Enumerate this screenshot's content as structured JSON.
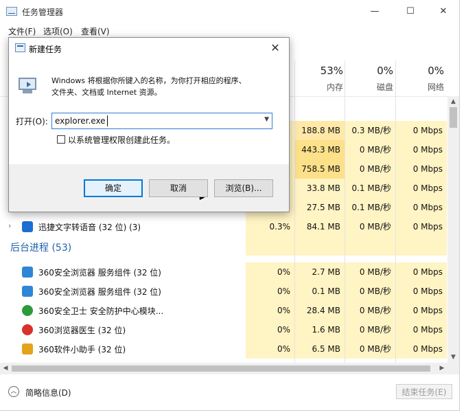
{
  "window": {
    "title": "任务管理器",
    "controls": {
      "minimize": "—",
      "maximize": "☐",
      "close": "✕"
    }
  },
  "menu": [
    "文件(F)",
    "选项(O)",
    "查看(V)"
  ],
  "columns": [
    {
      "pct": "53%",
      "label": "内存"
    },
    {
      "pct": "0%",
      "label": "磁盘"
    },
    {
      "pct": "0%",
      "label": "网络"
    }
  ],
  "top_rows": [
    {
      "cpu": "",
      "mem": "188.8 MB",
      "disk": "0.3 MB/秒",
      "net": "0 Mbps"
    },
    {
      "cpu": "",
      "mem": "443.3 MB",
      "disk": "0 MB/秒",
      "net": "0 Mbps"
    },
    {
      "cpu": "",
      "mem": "758.5 MB",
      "disk": "0 MB/秒",
      "net": "0 Mbps"
    },
    {
      "cpu": "",
      "mem": "33.8 MB",
      "disk": "0.1 MB/秒",
      "net": "0 Mbps"
    },
    {
      "cpu": "",
      "mem": "27.5 MB",
      "disk": "0.1 MB/秒",
      "net": "0 Mbps"
    },
    {
      "name": "迅捷文字转语音 (32 位) (3)",
      "cpu": "0.3%",
      "mem": "84.1 MB",
      "disk": "0 MB/秒",
      "net": "0 Mbps"
    }
  ],
  "background_section": {
    "title": "后台进程 (53)"
  },
  "bg_rows": [
    {
      "name": "360安全浏览器 服务组件 (32 位)",
      "cpu": "0%",
      "mem": "2.7 MB",
      "disk": "0 MB/秒",
      "net": "0 Mbps"
    },
    {
      "name": "360安全浏览器 服务组件 (32 位)",
      "cpu": "0%",
      "mem": "0.1 MB",
      "disk": "0 MB/秒",
      "net": "0 Mbps"
    },
    {
      "name": "360安全卫士 安全防护中心模块...",
      "cpu": "0%",
      "mem": "28.4 MB",
      "disk": "0 MB/秒",
      "net": "0 Mbps"
    },
    {
      "name": "360浏览器医生 (32 位)",
      "cpu": "0%",
      "mem": "1.6 MB",
      "disk": "0 MB/秒",
      "net": "0 Mbps"
    },
    {
      "name": "360软件小助手 (32 位)",
      "cpu": "0%",
      "mem": "6.5 MB",
      "disk": "0 MB/秒",
      "net": "0 Mbps"
    }
  ],
  "footer": {
    "fewer_details": "简略信息(D)",
    "end_task": "结束任务(E)"
  },
  "dialog": {
    "title": "新建任务",
    "description_line1": "Windows 将根据你所键入的名称，为你打开相应的程序、",
    "description_line2": "文件夹、文档或 Internet 资源。",
    "open_label": "打开(O):",
    "open_value": "explorer.exe",
    "admin_checkbox_label": "以系统管理权限创建此任务。",
    "admin_checked": false,
    "ok": "确定",
    "cancel": "取消",
    "browse": "浏览(B)..."
  },
  "icons": {
    "app": "task-manager-icon",
    "run": "run-dialog-icon",
    "row_colors": [
      "#1b6fd1",
      "#2f86d6",
      "#2f86d6",
      "#2f9a3a",
      "#d9312b",
      "#e3a31a"
    ]
  }
}
